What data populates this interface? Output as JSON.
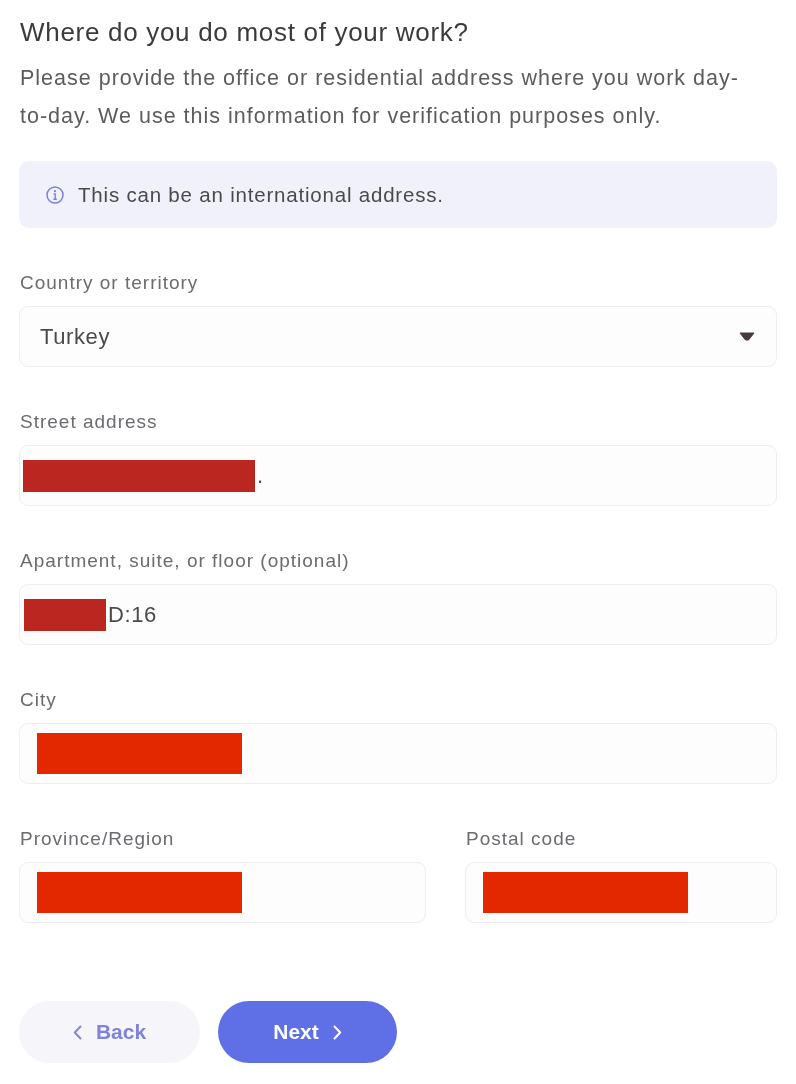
{
  "heading": "Where do you do most of your work?",
  "description": "Please provide the office or residential address where you work day-to-day. We use this information for verification purposes only.",
  "notice": {
    "text": "This can be an international address."
  },
  "fields": [
    {
      "kind": "select",
      "label": "Country or territory",
      "value": "Turkey"
    },
    {
      "kind": "text",
      "label": "Street address",
      "value": ".",
      "redaction": {
        "kind": "long",
        "color": "#bb2720"
      }
    },
    {
      "kind": "text",
      "label": "Apartment, suite, or floor (optional)",
      "value": "D:16",
      "redaction": {
        "kind": "short",
        "color": "#bb2720"
      }
    },
    {
      "kind": "text",
      "label": "City",
      "redaction": {
        "kind": "wide",
        "color": "#e32800"
      }
    }
  ],
  "split_row": [
    {
      "kind": "text",
      "label": "Province/Region",
      "redaction": {
        "kind": "wide",
        "color": "#e32800"
      }
    },
    {
      "kind": "text",
      "label": "Postal code",
      "redaction": {
        "kind": "wide",
        "color": "#e32800"
      }
    }
  ],
  "buttons": [
    {
      "kind": "back",
      "label": "Back"
    },
    {
      "kind": "next",
      "label": "Next"
    }
  ]
}
